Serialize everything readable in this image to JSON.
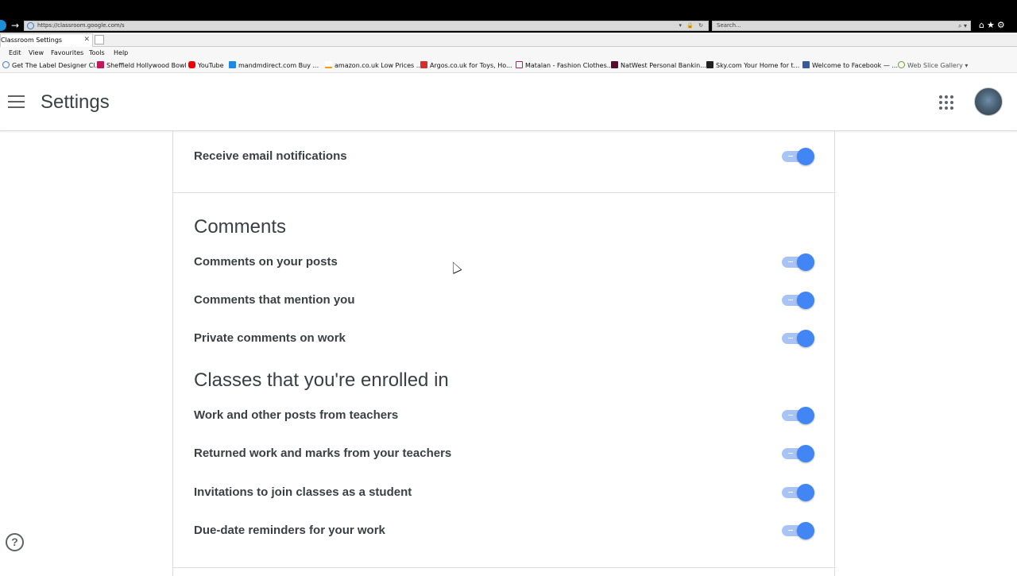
{
  "browser": {
    "address_url": "https://classroom.google.com/s",
    "search_placeholder": "Search...",
    "tab_title": "Classroom Settings",
    "menu": [
      "Edit",
      "View",
      "Favourites",
      "Tools",
      "Help"
    ],
    "favourites": [
      "Get The Label  Designer Cl...",
      "Sheffield  Hollywood Bowl",
      "YouTube",
      "mandmdirect.com  Buy ...",
      "amazon.co.uk Low Prices ...",
      "Argos.co.uk for Toys, Ho...",
      "Matalan - Fashion Clothes...",
      "NatWest Personal Bankin...",
      "Sky.com  Your Home for t...",
      "Welcome to Facebook — ...",
      "Web Slice Gallery ▾"
    ]
  },
  "header": {
    "title": "Settings"
  },
  "settings": {
    "email_row": {
      "label": "Receive email notifications",
      "on": true
    },
    "comments": {
      "title": "Comments",
      "items": [
        {
          "label": "Comments on your posts",
          "on": true
        },
        {
          "label": "Comments that mention you",
          "on": true
        },
        {
          "label": "Private comments on work",
          "on": true
        }
      ]
    },
    "enrolled": {
      "title": "Classes that you're enrolled in",
      "items": [
        {
          "label": "Work and other posts from teachers",
          "on": true
        },
        {
          "label": "Returned work and marks from your teachers",
          "on": true
        },
        {
          "label": "Invitations to join classes as a student",
          "on": true
        },
        {
          "label": "Due-date reminders for your work",
          "on": true
        }
      ]
    }
  },
  "help": {
    "symbol": "?"
  },
  "colors": {
    "toggle_track": "#a8c4f5",
    "toggle_thumb": "#4285f4",
    "text": "#3c4043"
  }
}
